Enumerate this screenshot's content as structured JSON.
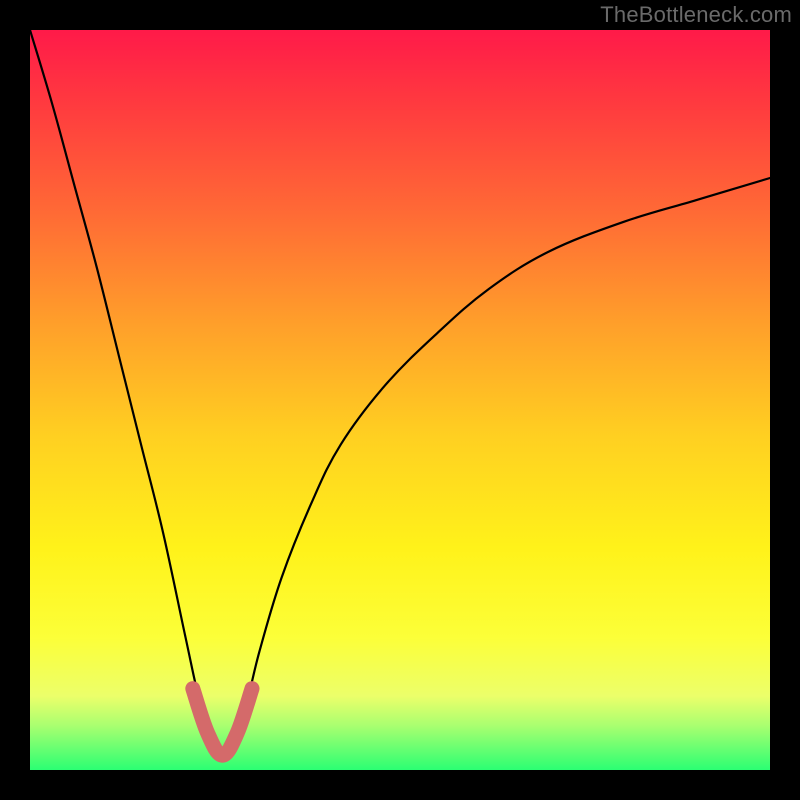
{
  "watermark": "TheBottleneck.com",
  "colors": {
    "frame": "#000000",
    "curve": "#000000",
    "highlight": "#d46a6a",
    "gradient_stops": [
      "#ff1a49",
      "#ff3a3f",
      "#ff6b35",
      "#ffa02a",
      "#ffd021",
      "#fff21a",
      "#fcff38",
      "#ecff6a",
      "#a9ff70",
      "#2bff73"
    ]
  },
  "chart_data": {
    "type": "line",
    "title": "",
    "xlabel": "",
    "ylabel": "",
    "xlim": [
      0,
      100
    ],
    "ylim": [
      0,
      100
    ],
    "legend": null,
    "grid": false,
    "notes": "V-shaped bottleneck curve. y ≈ 100 at x≈0; minimum y≈2 near x≈26; rises to y≈80 at x=100. Pink highlighted segment around the minimum (x≈22–30).",
    "series": [
      {
        "name": "bottleneck-curve",
        "x": [
          0,
          3,
          6,
          9,
          12,
          15,
          18,
          21,
          23,
          25,
          26,
          27,
          29,
          31,
          34,
          38,
          42,
          48,
          55,
          62,
          70,
          80,
          90,
          100
        ],
        "y": [
          100,
          90,
          79,
          68,
          56,
          44,
          32,
          18,
          9,
          3,
          2,
          3,
          8,
          16,
          26,
          36,
          44,
          52,
          59,
          65,
          70,
          74,
          77,
          80
        ]
      },
      {
        "name": "highlight-segment",
        "x": [
          22,
          24,
          26,
          28,
          30
        ],
        "y": [
          11,
          5,
          2,
          5,
          11
        ]
      }
    ]
  }
}
